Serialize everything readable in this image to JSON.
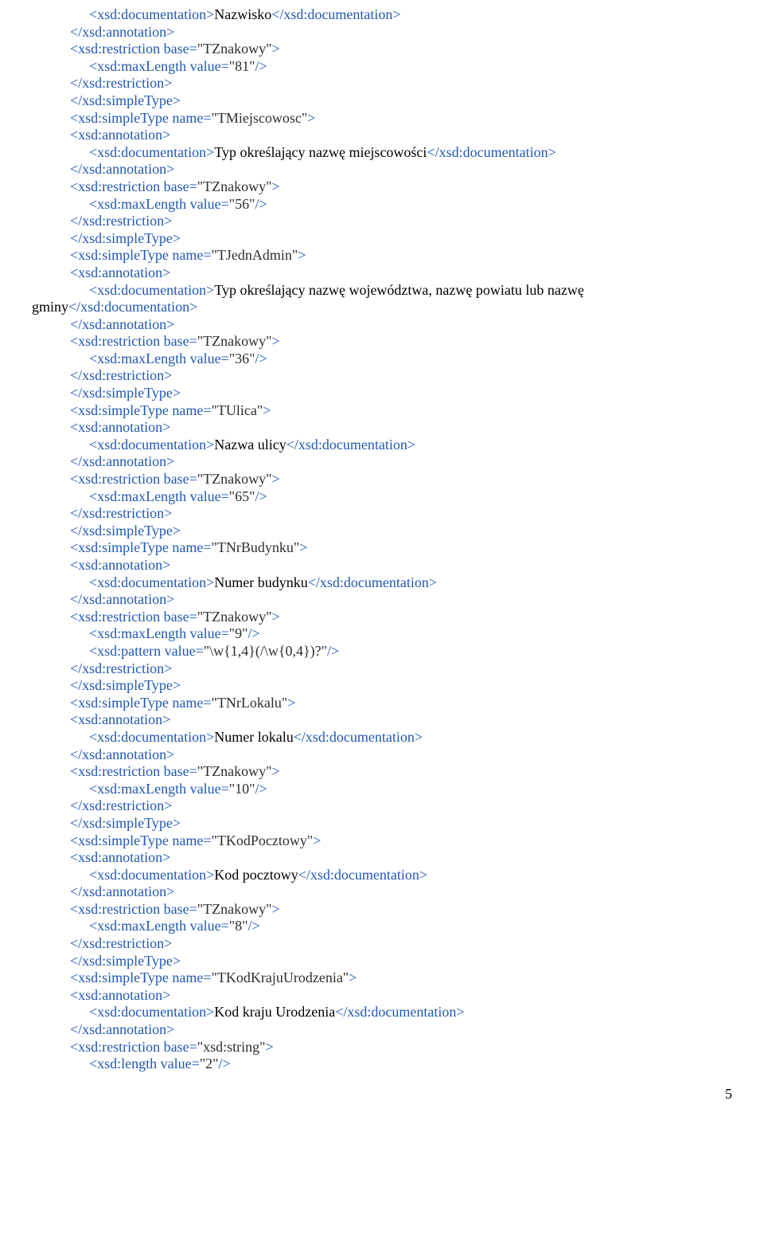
{
  "lines": [
    {
      "cls": "lvl2",
      "parts": [
        {
          "t": "tag",
          "s": "<xsd:documentation>"
        },
        {
          "t": "txt",
          "s": "Nazwisko"
        },
        {
          "t": "tag",
          "s": "</xsd:documentation>"
        }
      ]
    },
    {
      "cls": "lvl1",
      "parts": [
        {
          "t": "tag",
          "s": "</xsd:annotation>"
        }
      ]
    },
    {
      "cls": "lvl1",
      "parts": [
        {
          "t": "tag",
          "s": "<xsd:restriction base="
        },
        {
          "t": "attr",
          "s": "\"TZnakowy\""
        },
        {
          "t": "tag",
          "s": ">"
        }
      ]
    },
    {
      "cls": "lvl2",
      "parts": [
        {
          "t": "tag",
          "s": "<xsd:maxLength value="
        },
        {
          "t": "attr",
          "s": "\"81\""
        },
        {
          "t": "tag",
          "s": "/>"
        }
      ]
    },
    {
      "cls": "lvl1",
      "parts": [
        {
          "t": "tag",
          "s": "</xsd:restriction>"
        }
      ]
    },
    {
      "cls": "lvl1",
      "parts": [
        {
          "t": "tag",
          "s": "</xsd:simpleType>"
        }
      ]
    },
    {
      "cls": "lvl1",
      "parts": [
        {
          "t": "tag",
          "s": "<xsd:simpleType name="
        },
        {
          "t": "attr",
          "s": "\"TMiejscowosc\""
        },
        {
          "t": "tag",
          "s": ">"
        }
      ]
    },
    {
      "cls": "lvl1",
      "parts": [
        {
          "t": "tag",
          "s": "<xsd:annotation>"
        }
      ]
    },
    {
      "cls": "lvl2",
      "parts": [
        {
          "t": "tag",
          "s": "<xsd:documentation>"
        },
        {
          "t": "txt",
          "s": "Typ określający nazwę miejscowości"
        },
        {
          "t": "tag",
          "s": "</xsd:documentation>"
        }
      ]
    },
    {
      "cls": "lvl1",
      "parts": [
        {
          "t": "tag",
          "s": "</xsd:annotation>"
        }
      ]
    },
    {
      "cls": "lvl1",
      "parts": [
        {
          "t": "tag",
          "s": "<xsd:restriction base="
        },
        {
          "t": "attr",
          "s": "\"TZnakowy\""
        },
        {
          "t": "tag",
          "s": ">"
        }
      ]
    },
    {
      "cls": "lvl2",
      "parts": [
        {
          "t": "tag",
          "s": "<xsd:maxLength value="
        },
        {
          "t": "attr",
          "s": "\"56\""
        },
        {
          "t": "tag",
          "s": "/>"
        }
      ]
    },
    {
      "cls": "lvl1",
      "parts": [
        {
          "t": "tag",
          "s": "</xsd:restriction>"
        }
      ]
    },
    {
      "cls": "lvl1",
      "parts": [
        {
          "t": "tag",
          "s": "</xsd:simpleType>"
        }
      ]
    },
    {
      "cls": "lvl1",
      "parts": [
        {
          "t": "tag",
          "s": "<xsd:simpleType name="
        },
        {
          "t": "attr",
          "s": "\"TJednAdmin\""
        },
        {
          "t": "tag",
          "s": ">"
        }
      ]
    },
    {
      "cls": "lvl1",
      "parts": [
        {
          "t": "tag",
          "s": "<xsd:annotation>"
        }
      ]
    },
    {
      "cls": "lvl2",
      "parts": [
        {
          "t": "tag",
          "s": "<xsd:documentation>"
        },
        {
          "t": "txt",
          "s": "Typ określający nazwę województwa, nazwę powiatu lub nazwę "
        }
      ]
    },
    {
      "cls": "lvl0",
      "parts": [
        {
          "t": "txt",
          "s": "gminy"
        },
        {
          "t": "tag",
          "s": "</xsd:documentation>"
        }
      ]
    },
    {
      "cls": "lvl1",
      "parts": [
        {
          "t": "tag",
          "s": "</xsd:annotation>"
        }
      ]
    },
    {
      "cls": "lvl1",
      "parts": [
        {
          "t": "tag",
          "s": "<xsd:restriction base="
        },
        {
          "t": "attr",
          "s": "\"TZnakowy\""
        },
        {
          "t": "tag",
          "s": ">"
        }
      ]
    },
    {
      "cls": "lvl2",
      "parts": [
        {
          "t": "tag",
          "s": "<xsd:maxLength value="
        },
        {
          "t": "attr",
          "s": "\"36\""
        },
        {
          "t": "tag",
          "s": "/>"
        }
      ]
    },
    {
      "cls": "lvl1",
      "parts": [
        {
          "t": "tag",
          "s": "</xsd:restriction>"
        }
      ]
    },
    {
      "cls": "lvl1",
      "parts": [
        {
          "t": "tag",
          "s": "</xsd:simpleType>"
        }
      ]
    },
    {
      "cls": "lvl1",
      "parts": [
        {
          "t": "tag",
          "s": "<xsd:simpleType name="
        },
        {
          "t": "attr",
          "s": "\"TUlica\""
        },
        {
          "t": "tag",
          "s": ">"
        }
      ]
    },
    {
      "cls": "lvl1",
      "parts": [
        {
          "t": "tag",
          "s": "<xsd:annotation>"
        }
      ]
    },
    {
      "cls": "lvl2",
      "parts": [
        {
          "t": "tag",
          "s": "<xsd:documentation>"
        },
        {
          "t": "txt",
          "s": "Nazwa ulicy"
        },
        {
          "t": "tag",
          "s": "</xsd:documentation>"
        }
      ]
    },
    {
      "cls": "lvl1",
      "parts": [
        {
          "t": "tag",
          "s": "</xsd:annotation>"
        }
      ]
    },
    {
      "cls": "lvl1",
      "parts": [
        {
          "t": "tag",
          "s": "<xsd:restriction base="
        },
        {
          "t": "attr",
          "s": "\"TZnakowy\""
        },
        {
          "t": "tag",
          "s": ">"
        }
      ]
    },
    {
      "cls": "lvl2",
      "parts": [
        {
          "t": "tag",
          "s": "<xsd:maxLength value="
        },
        {
          "t": "attr",
          "s": "\"65\""
        },
        {
          "t": "tag",
          "s": "/>"
        }
      ]
    },
    {
      "cls": "lvl1",
      "parts": [
        {
          "t": "tag",
          "s": "</xsd:restriction>"
        }
      ]
    },
    {
      "cls": "lvl1",
      "parts": [
        {
          "t": "tag",
          "s": "</xsd:simpleType>"
        }
      ]
    },
    {
      "cls": "lvl1",
      "parts": [
        {
          "t": "tag",
          "s": "<xsd:simpleType name="
        },
        {
          "t": "attr",
          "s": "\"TNrBudynku\""
        },
        {
          "t": "tag",
          "s": ">"
        }
      ]
    },
    {
      "cls": "lvl1",
      "parts": [
        {
          "t": "tag",
          "s": "<xsd:annotation>"
        }
      ]
    },
    {
      "cls": "lvl2",
      "parts": [
        {
          "t": "tag",
          "s": "<xsd:documentation>"
        },
        {
          "t": "txt",
          "s": "Numer budynku"
        },
        {
          "t": "tag",
          "s": "</xsd:documentation>"
        }
      ]
    },
    {
      "cls": "lvl1",
      "parts": [
        {
          "t": "tag",
          "s": "</xsd:annotation>"
        }
      ]
    },
    {
      "cls": "lvl1",
      "parts": [
        {
          "t": "tag",
          "s": "<xsd:restriction base="
        },
        {
          "t": "attr",
          "s": "\"TZnakowy\""
        },
        {
          "t": "tag",
          "s": ">"
        }
      ]
    },
    {
      "cls": "lvl2",
      "parts": [
        {
          "t": "tag",
          "s": "<xsd:maxLength value="
        },
        {
          "t": "attr",
          "s": "\"9\""
        },
        {
          "t": "tag",
          "s": "/>"
        }
      ]
    },
    {
      "cls": "lvl2",
      "parts": [
        {
          "t": "tag",
          "s": "<xsd:pattern value="
        },
        {
          "t": "attr",
          "s": "\"\\w{1,4}(/\\w{0,4})?\""
        },
        {
          "t": "tag",
          "s": "/>"
        }
      ]
    },
    {
      "cls": "lvl1",
      "parts": [
        {
          "t": "tag",
          "s": "</xsd:restriction>"
        }
      ]
    },
    {
      "cls": "lvl1",
      "parts": [
        {
          "t": "tag",
          "s": "</xsd:simpleType>"
        }
      ]
    },
    {
      "cls": "lvl1",
      "parts": [
        {
          "t": "tag",
          "s": "<xsd:simpleType name="
        },
        {
          "t": "attr",
          "s": "\"TNrLokalu\""
        },
        {
          "t": "tag",
          "s": ">"
        }
      ]
    },
    {
      "cls": "lvl1",
      "parts": [
        {
          "t": "tag",
          "s": "<xsd:annotation>"
        }
      ]
    },
    {
      "cls": "lvl2",
      "parts": [
        {
          "t": "tag",
          "s": "<xsd:documentation>"
        },
        {
          "t": "txt",
          "s": "Numer lokalu"
        },
        {
          "t": "tag",
          "s": "</xsd:documentation>"
        }
      ]
    },
    {
      "cls": "lvl1",
      "parts": [
        {
          "t": "tag",
          "s": "</xsd:annotation>"
        }
      ]
    },
    {
      "cls": "lvl1",
      "parts": [
        {
          "t": "tag",
          "s": "<xsd:restriction base="
        },
        {
          "t": "attr",
          "s": "\"TZnakowy\""
        },
        {
          "t": "tag",
          "s": ">"
        }
      ]
    },
    {
      "cls": "lvl2",
      "parts": [
        {
          "t": "tag",
          "s": "<xsd:maxLength value="
        },
        {
          "t": "attr",
          "s": "\"10\""
        },
        {
          "t": "tag",
          "s": "/>"
        }
      ]
    },
    {
      "cls": "lvl1",
      "parts": [
        {
          "t": "tag",
          "s": "</xsd:restriction>"
        }
      ]
    },
    {
      "cls": "lvl1",
      "parts": [
        {
          "t": "tag",
          "s": "</xsd:simpleType>"
        }
      ]
    },
    {
      "cls": "lvl1",
      "parts": [
        {
          "t": "tag",
          "s": "<xsd:simpleType name="
        },
        {
          "t": "attr",
          "s": "\"TKodPocztowy\""
        },
        {
          "t": "tag",
          "s": ">"
        }
      ]
    },
    {
      "cls": "lvl1",
      "parts": [
        {
          "t": "tag",
          "s": "<xsd:annotation>"
        }
      ]
    },
    {
      "cls": "lvl2",
      "parts": [
        {
          "t": "tag",
          "s": "<xsd:documentation>"
        },
        {
          "t": "txt",
          "s": "Kod pocztowy"
        },
        {
          "t": "tag",
          "s": "</xsd:documentation>"
        }
      ]
    },
    {
      "cls": "lvl1",
      "parts": [
        {
          "t": "tag",
          "s": "</xsd:annotation>"
        }
      ]
    },
    {
      "cls": "lvl1",
      "parts": [
        {
          "t": "tag",
          "s": "<xsd:restriction base="
        },
        {
          "t": "attr",
          "s": "\"TZnakowy\""
        },
        {
          "t": "tag",
          "s": ">"
        }
      ]
    },
    {
      "cls": "lvl2",
      "parts": [
        {
          "t": "tag",
          "s": "<xsd:maxLength value="
        },
        {
          "t": "attr",
          "s": "\"8\""
        },
        {
          "t": "tag",
          "s": "/>"
        }
      ]
    },
    {
      "cls": "lvl1",
      "parts": [
        {
          "t": "tag",
          "s": "</xsd:restriction>"
        }
      ]
    },
    {
      "cls": "lvl1",
      "parts": [
        {
          "t": "tag",
          "s": "</xsd:simpleType>"
        }
      ]
    },
    {
      "cls": "lvl1",
      "parts": [
        {
          "t": "tag",
          "s": "<xsd:simpleType name="
        },
        {
          "t": "attr",
          "s": "\"TKodKrajuUrodzenia\""
        },
        {
          "t": "tag",
          "s": ">"
        }
      ]
    },
    {
      "cls": "lvl1",
      "parts": [
        {
          "t": "tag",
          "s": "<xsd:annotation>"
        }
      ]
    },
    {
      "cls": "lvl2",
      "parts": [
        {
          "t": "tag",
          "s": "<xsd:documentation>"
        },
        {
          "t": "txt",
          "s": "Kod kraju Urodzenia"
        },
        {
          "t": "tag",
          "s": "</xsd:documentation>"
        }
      ]
    },
    {
      "cls": "lvl1",
      "parts": [
        {
          "t": "tag",
          "s": "</xsd:annotation>"
        }
      ]
    },
    {
      "cls": "lvl1",
      "parts": [
        {
          "t": "tag",
          "s": "<xsd:restriction base="
        },
        {
          "t": "attr",
          "s": "\"xsd:string\""
        },
        {
          "t": "tag",
          "s": ">"
        }
      ]
    },
    {
      "cls": "lvl2",
      "parts": [
        {
          "t": "tag",
          "s": "<xsd:length value="
        },
        {
          "t": "attr",
          "s": "\"2\""
        },
        {
          "t": "tag",
          "s": "/>"
        }
      ]
    }
  ],
  "pageno": "5"
}
